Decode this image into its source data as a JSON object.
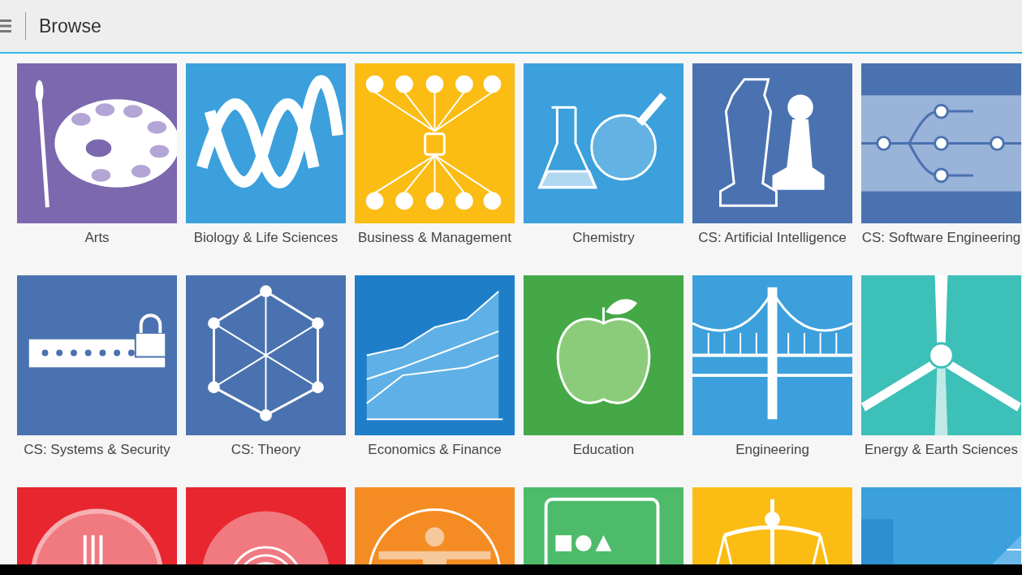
{
  "header": {
    "title": "Browse"
  },
  "tiles": [
    {
      "label": "Arts",
      "color": "#7b68ae"
    },
    {
      "label": "Biology & Life Sciences",
      "color": "#3ba0dc"
    },
    {
      "label": "Business & Management",
      "color": "#fbbc13"
    },
    {
      "label": "Chemistry",
      "color": "#3ba0dc"
    },
    {
      "label": "CS: Artificial Intelligence",
      "color": "#4a72b0"
    },
    {
      "label": "CS: Software Engineering",
      "color": "#4a72b0"
    },
    {
      "label": "CS: Systems & Security",
      "color": "#4a72b0"
    },
    {
      "label": "CS: Theory",
      "color": "#4a72b0"
    },
    {
      "label": "Economics & Finance",
      "color": "#1e7fc8"
    },
    {
      "label": "Education",
      "color": "#44a846"
    },
    {
      "label": "Engineering",
      "color": "#3ba0dc"
    },
    {
      "label": "Energy & Earth Sciences",
      "color": "#3cc0b8"
    },
    {
      "color": "#e8262f"
    },
    {
      "color": "#e8262f"
    },
    {
      "color": "#f58c23"
    },
    {
      "color": "#4dbb6a"
    },
    {
      "color": "#fbbc13"
    },
    {
      "color": "#3ba0dc"
    }
  ]
}
